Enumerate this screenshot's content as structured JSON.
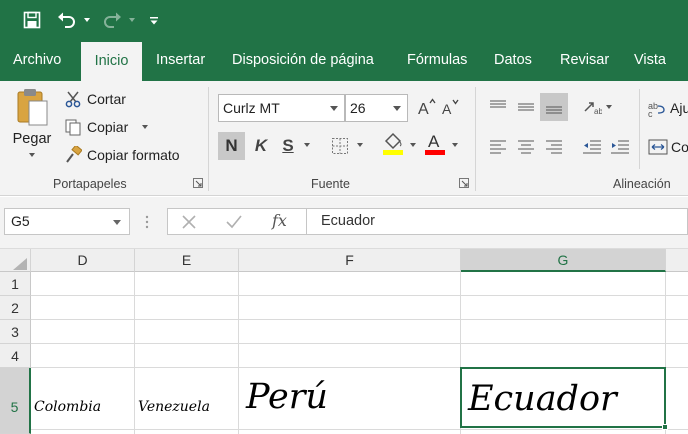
{
  "qat": {
    "icons": [
      "save-icon",
      "undo-icon",
      "undo-dropdown-icon",
      "redo-icon",
      "redo-dropdown-icon",
      "customize-qat-icon"
    ]
  },
  "ribbon_tabs": [
    {
      "label": "Archivo"
    },
    {
      "label": "Inicio",
      "active": true
    },
    {
      "label": "Insertar"
    },
    {
      "label": "Disposición de página"
    },
    {
      "label": "Fórmulas"
    },
    {
      "label": "Datos"
    },
    {
      "label": "Revisar"
    },
    {
      "label": "Vista"
    }
  ],
  "clipboard": {
    "paste": "Pegar",
    "cut": "Cortar",
    "copy": "Copiar",
    "format_painter": "Copiar formato",
    "group_label": "Portapapeles"
  },
  "font": {
    "name": "Curlz MT",
    "size": "26",
    "bold": "N",
    "italic": "K",
    "underline": "S",
    "group_label": "Fuente",
    "highlight_color": "#ffff00",
    "font_color": "#ff0000"
  },
  "alignment": {
    "group_label": "Alineación",
    "wrap_partial": "Aju",
    "merge_partial": "Co"
  },
  "formula_bar": {
    "name_box": "G5",
    "fx": "fx",
    "content": "Ecuador"
  },
  "sheet": {
    "columns": [
      {
        "label": "D"
      },
      {
        "label": "E"
      },
      {
        "label": "F"
      },
      {
        "label": "G",
        "selected": true
      }
    ],
    "rows": [
      {
        "label": "1"
      },
      {
        "label": "2"
      },
      {
        "label": "3"
      },
      {
        "label": "4"
      },
      {
        "label": "5",
        "selected": true
      }
    ],
    "cells": {
      "D5": "Colombia",
      "E5": "Venezuela",
      "F5": "Perú",
      "G5": "Ecuador"
    }
  },
  "colors": {
    "excel_green": "#217346",
    "ribbon_bg": "#f3f3f3"
  }
}
